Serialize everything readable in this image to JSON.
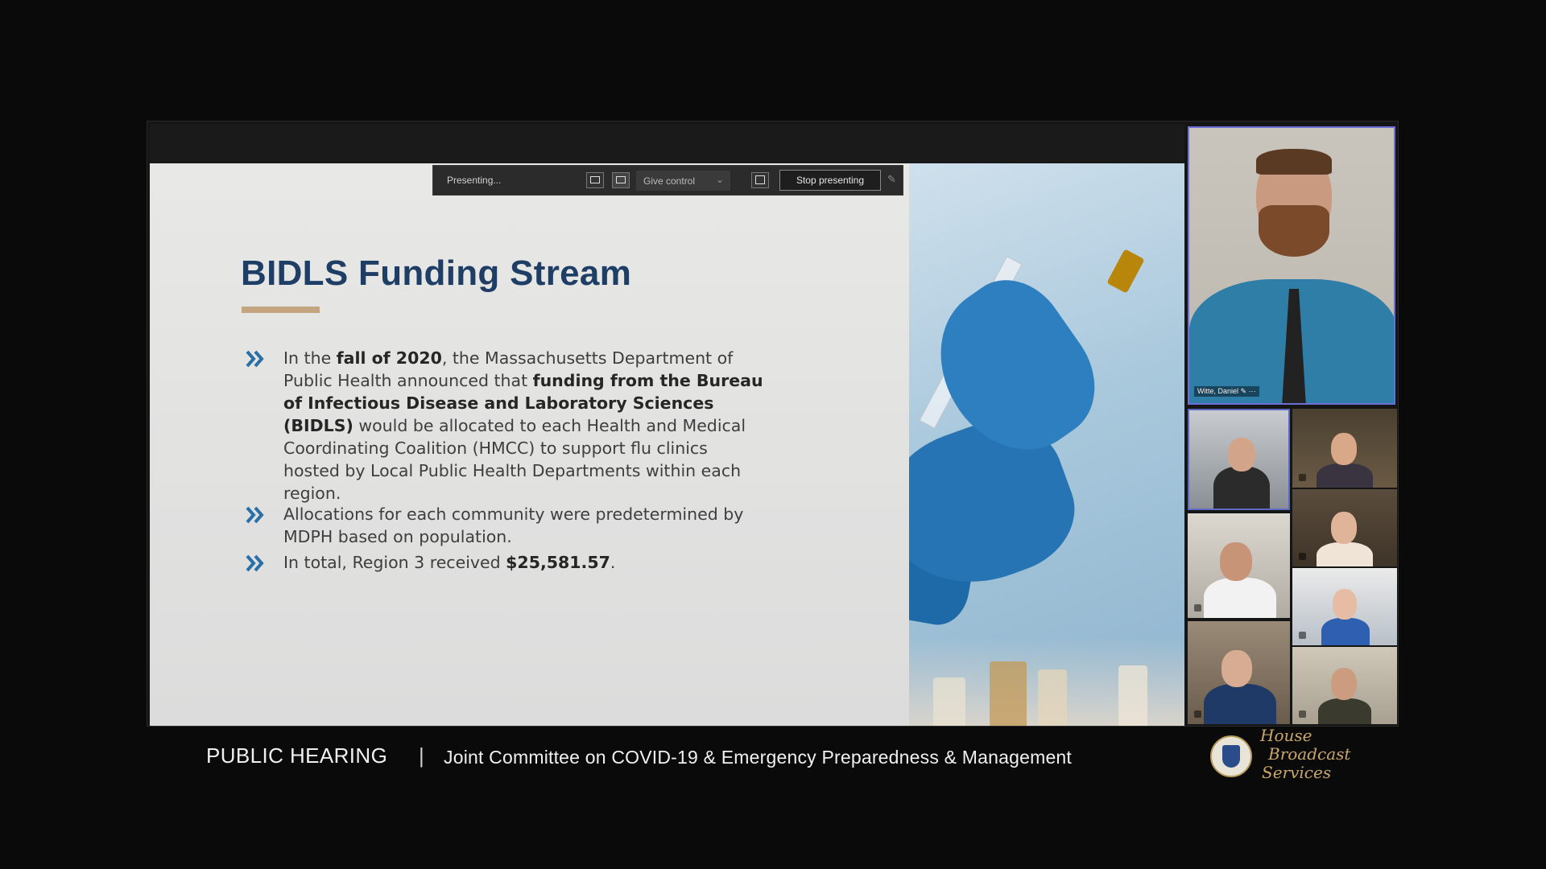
{
  "presenting_bar": {
    "status": "Presenting...",
    "give_control": "Give control",
    "stop_presenting": "Stop presenting"
  },
  "slide": {
    "title": "BIDLS Funding Stream",
    "accent_color": "#c3a57f",
    "title_color": "#1f3e66",
    "bullet1": {
      "p1": "In the ",
      "b1": "fall of 2020",
      "p2": ", the Massachusetts Department of Public Health announced that ",
      "b2": "funding from the Bureau of Infectious Disease and Laboratory Sciences (BIDLS)",
      "p3": " would be allocated to each Health and Medical Coordinating Coalition (HMCC) to support flu clinics hosted by Local Public Health Departments within each region."
    },
    "bullet2": {
      "text": "Allocations for each community were predetermined by MDPH based on population."
    },
    "bullet3": {
      "p1": "In total, Region 3 received ",
      "b1": "$25,581.57",
      "p2": "."
    }
  },
  "participants": {
    "main_name": "Witte, Daniel"
  },
  "lower_third": {
    "label": "PUBLIC HEARING",
    "separator": "|",
    "committee": "Joint Committee on COVID-19 & Emergency Preparedness & Management",
    "brand_line1": "House",
    "brand_line2": "Broadcast",
    "brand_line3": "Services"
  }
}
